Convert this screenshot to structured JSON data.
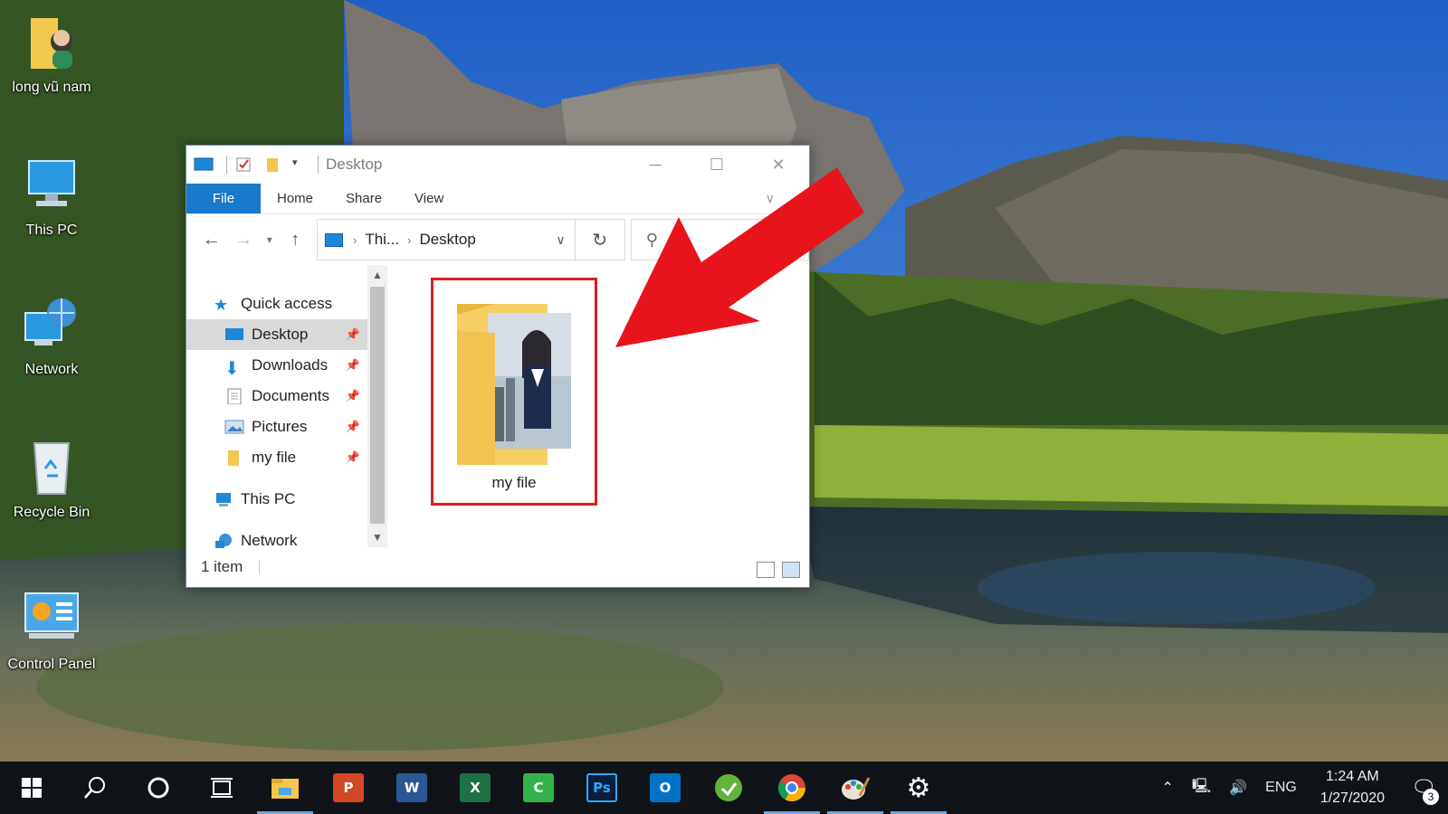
{
  "desktop": {
    "icons": [
      {
        "label": "long vũ nam",
        "icon": "user-folder-icon"
      },
      {
        "label": "This PC",
        "icon": "this-pc-icon"
      },
      {
        "label": "Network",
        "icon": "network-icon"
      },
      {
        "label": "Recycle Bin",
        "icon": "recycle-bin-icon"
      },
      {
        "label": "Control Panel",
        "icon": "control-panel-icon"
      }
    ]
  },
  "explorer": {
    "title": "Desktop",
    "ribbon": {
      "file": "File",
      "home": "Home",
      "share": "Share",
      "view": "View"
    },
    "address": {
      "segments": [
        "Thi...",
        "Desktop"
      ]
    },
    "nav": {
      "quick_access": "Quick access",
      "items": [
        {
          "label": "Desktop",
          "icon": "desktop-icon",
          "pinned": true,
          "selected": true
        },
        {
          "label": "Downloads",
          "icon": "downloads-icon",
          "pinned": true
        },
        {
          "label": "Documents",
          "icon": "documents-icon",
          "pinned": true
        },
        {
          "label": "Pictures",
          "icon": "pictures-icon",
          "pinned": true
        },
        {
          "label": "my file",
          "icon": "folder-icon",
          "pinned": true
        }
      ],
      "this_pc": "This PC",
      "network": "Network"
    },
    "files": [
      {
        "name": "my file",
        "type": "folder"
      }
    ],
    "status": "1 item"
  },
  "taskbar": {
    "apps": [
      "start",
      "search",
      "cortana",
      "task-view",
      "file-explorer",
      "powerpoint",
      "word",
      "excel",
      "camtasia",
      "photoshop",
      "outlook",
      "app-green",
      "chrome",
      "paint",
      "settings"
    ],
    "tray": {
      "language": "ENG",
      "time": "1:24 AM",
      "date": "1/27/2020",
      "notifications": "3"
    }
  },
  "colors": {
    "accent": "#1979ca",
    "highlight_box": "#d91e24",
    "arrow": "#e8141c",
    "taskbar": "#101419"
  }
}
